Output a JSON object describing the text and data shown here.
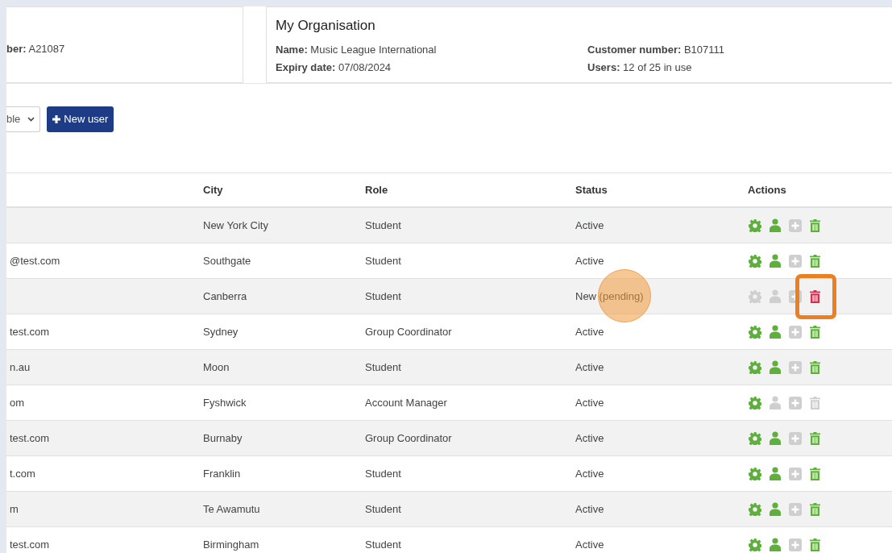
{
  "account_card": {
    "fields": [
      "**ber:** A21087"
    ]
  },
  "organisation_card": {
    "title": "My Organisation",
    "fields": [
      "**Name:** Music League International",
      "**Customer number:** B107111",
      "**Expiry date:** 07/08/2024",
      "**Users:** 12 of 25 in use"
    ]
  },
  "toolbar": {
    "filter_select": "ble",
    "new_user_button": "New user"
  },
  "table": {
    "columns": [
      "City",
      "Role",
      "Status",
      "Actions"
    ],
    "rows": [
      {
        "city": "New York City",
        "role": "Student",
        "status": "Active",
        "click_marker": false,
        "actions": [
          {
            "kind": "gear",
            "disabled": false
          },
          {
            "kind": "user",
            "disabled": false
          },
          {
            "kind": "plus",
            "disabled": true
          },
          {
            "kind": "trash",
            "disabled": false,
            "highlighted": false
          }
        ]
      },
      {
        "column_1": "@test.com",
        "city": "Southgate",
        "role": "Student",
        "status": "Active",
        "click_marker": false,
        "actions": [
          {
            "kind": "gear",
            "disabled": false
          },
          {
            "kind": "user",
            "disabled": false
          },
          {
            "kind": "plus",
            "disabled": true
          },
          {
            "kind": "trash",
            "disabled": false,
            "highlighted": false
          }
        ]
      },
      {
        "city": "Canberra",
        "role": "Student",
        "status": "New (pending)",
        "click_marker": true,
        "actions": [
          {
            "kind": "gear",
            "disabled": true
          },
          {
            "kind": "user",
            "disabled": true
          },
          {
            "kind": "plus",
            "disabled": true
          },
          {
            "kind": "trash",
            "highlighted": true
          }
        ]
      },
      {
        "column_1": "test.com",
        "city": "Sydney",
        "role": "Group Coordinator",
        "status": "Active",
        "click_marker": false,
        "actions": [
          {
            "kind": "gear",
            "disabled": false
          },
          {
            "kind": "user",
            "disabled": false
          },
          {
            "kind": "plus",
            "disabled": true
          },
          {
            "kind": "trash",
            "disabled": false,
            "highlighted": false
          }
        ]
      },
      {
        "column_1": "n.au",
        "city": "Moon",
        "role": "Student",
        "status": "Active",
        "click_marker": false,
        "actions": [
          {
            "kind": "gear",
            "disabled": false
          },
          {
            "kind": "user",
            "disabled": false
          },
          {
            "kind": "plus",
            "disabled": true
          },
          {
            "kind": "trash",
            "disabled": false,
            "highlighted": false
          }
        ]
      },
      {
        "column_1": "om",
        "city": "Fyshwick",
        "role": "Account Manager",
        "status": "Active",
        "click_marker": false,
        "actions": [
          {
            "kind": "gear",
            "disabled": false
          },
          {
            "kind": "user",
            "disabled": true
          },
          {
            "kind": "plus",
            "disabled": true
          },
          {
            "kind": "trash",
            "disabled": true,
            "highlighted": false
          }
        ]
      },
      {
        "column_1": "test.com",
        "city": "Burnaby",
        "role": "Group Coordinator",
        "status": "Active",
        "click_marker": false,
        "actions": [
          {
            "kind": "gear",
            "disabled": false
          },
          {
            "kind": "user",
            "disabled": false
          },
          {
            "kind": "plus",
            "disabled": true
          },
          {
            "kind": "trash",
            "disabled": false,
            "highlighted": false
          }
        ]
      },
      {
        "column_1": "t.com",
        "city": "Franklin",
        "role": "Student",
        "status": "Active",
        "click_marker": false,
        "actions": [
          {
            "kind": "gear",
            "disabled": false
          },
          {
            "kind": "user",
            "disabled": false
          },
          {
            "kind": "plus",
            "disabled": true
          },
          {
            "kind": "trash",
            "disabled": false,
            "highlighted": false
          }
        ]
      },
      {
        "column_1": "m",
        "city": "Te Awamutu",
        "role": "Student",
        "status": "Active",
        "click_marker": false,
        "actions": [
          {
            "kind": "gear",
            "disabled": false
          },
          {
            "kind": "user",
            "disabled": false
          },
          {
            "kind": "plus",
            "disabled": true
          },
          {
            "kind": "trash",
            "disabled": false,
            "highlighted": false
          }
        ]
      },
      {
        "column_1": "test.com",
        "city": "Birmingham",
        "role": "Student",
        "status": "Active",
        "click_marker": false,
        "actions": [
          {
            "kind": "gear",
            "disabled": false
          },
          {
            "kind": "user",
            "disabled": false
          },
          {
            "kind": "plus",
            "disabled": true
          },
          {
            "kind": "trash",
            "disabled": false,
            "highlighted": false
          }
        ]
      }
    ]
  }
}
